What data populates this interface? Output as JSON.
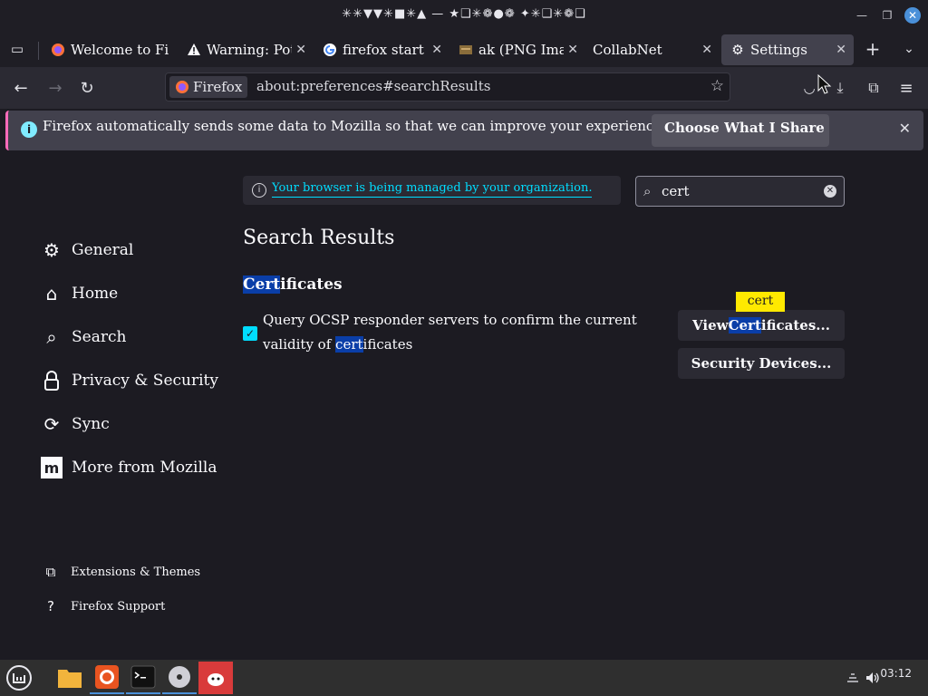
{
  "window": {
    "title": "✳✳▼▼✳■✳▲ — ★❑✳❁●❁ ✦✳❑✳❁❑"
  },
  "tabs": [
    {
      "label": "Welcome to Fi",
      "icon": "firefox-logo-icon"
    },
    {
      "label": "Warning: Pot",
      "icon": "warning-icon"
    },
    {
      "label": "firefox start p",
      "icon": "google-logo-icon"
    },
    {
      "label": "ak (PNG Ima",
      "icon": "image-icon"
    },
    {
      "label": "CollabNet",
      "icon": ""
    },
    {
      "label": "Settings",
      "icon": "gear-icon",
      "active": true
    }
  ],
  "navbar": {
    "identity_label": "Firefox",
    "url": "about:preferences#searchResults"
  },
  "notification": {
    "text": "Firefox automatically sends some data to Mozilla so that we can improve your experience.",
    "button": "Choose What I Share"
  },
  "managed": {
    "link": "Your browser is being managed by your organization."
  },
  "search": {
    "value": "cert"
  },
  "sidebar": {
    "items": [
      {
        "label": "General",
        "icon": "gear-icon"
      },
      {
        "label": "Home",
        "icon": "home-icon"
      },
      {
        "label": "Search",
        "icon": "search-icon"
      },
      {
        "label": "Privacy & Security",
        "icon": "lock-icon"
      },
      {
        "label": "Sync",
        "icon": "sync-icon"
      },
      {
        "label": "More from Mozilla",
        "icon": "mozilla-icon"
      }
    ],
    "bottom": [
      {
        "label": "Extensions & Themes",
        "icon": "puzzle-icon"
      },
      {
        "label": "Firefox Support",
        "icon": "help-icon"
      }
    ]
  },
  "main": {
    "heading": "Search Results",
    "section_title_hl": "Cert",
    "section_title_rest": "ificates",
    "ocsp_part1": "Query OCSP responder servers to confirm the current validity of ",
    "ocsp_hl": "cert",
    "ocsp_part2": "ificates",
    "view_cert_pre": "View ",
    "view_cert_hl": "Cert",
    "view_cert_post": "ificates...",
    "security_devices": "Security Devices...",
    "tooltip": "cert"
  },
  "taskbar": {
    "clock": "03:12"
  },
  "colors": {
    "accent": "#00ddff",
    "highlight": "#0a3ea8",
    "tooltip": "#ffe900"
  }
}
